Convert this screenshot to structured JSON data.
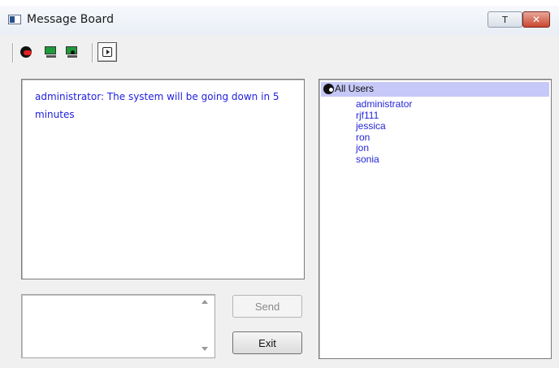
{
  "window": {
    "title": "Message Board",
    "restore_label": "T",
    "close_label": "✕"
  },
  "toolbar": {
    "tools": [
      {
        "icon": "disconnect-face-icon"
      },
      {
        "icon": "computer-icon"
      },
      {
        "icon": "computer-icon"
      },
      {
        "icon": "toggle-panel-icon"
      }
    ]
  },
  "messages": {
    "text": "administrator: The system will be going down in 5 minutes"
  },
  "compose": {
    "value": "",
    "send_label": "Send",
    "exit_label": "Exit"
  },
  "users": {
    "header": "All Users",
    "items": [
      "administrator",
      "rjf111",
      "jessica",
      "ron",
      "jon",
      "sonia"
    ]
  },
  "colors": {
    "message_text": "#2020e0",
    "user_text": "#2525d8",
    "header_bg": "#c6c8f7",
    "close_button": "#c9472f"
  }
}
